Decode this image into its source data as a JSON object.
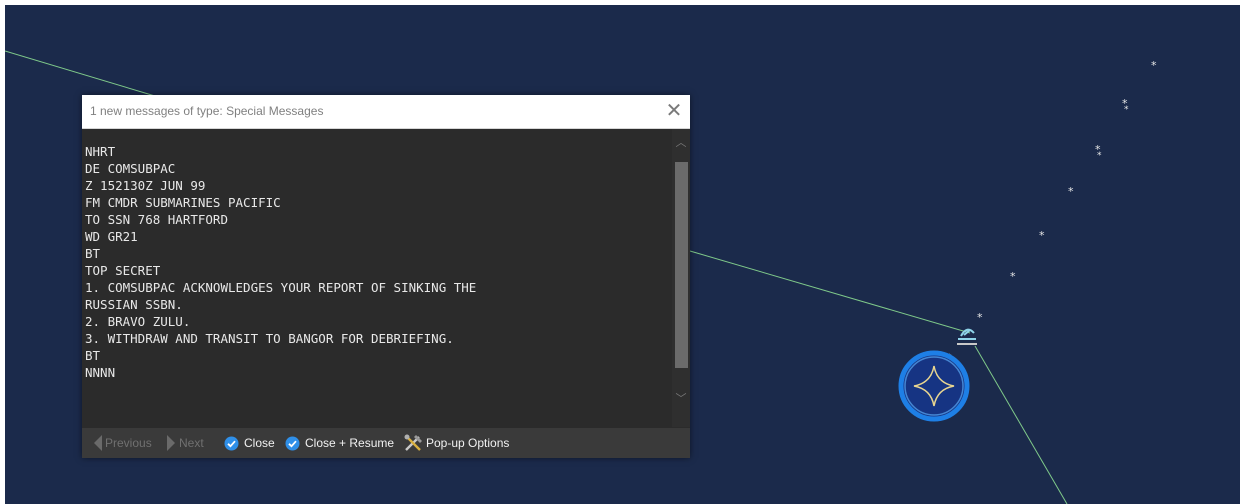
{
  "popup": {
    "title": "1 new messages of type: Special Messages",
    "close_glyph": "✕",
    "message_lines": [
      "NHRT",
      "DE COMSUBPAC",
      "Z 152130Z JUN 99",
      "FM CMDR SUBMARINES PACIFIC",
      "TO SSN 768 HARTFORD",
      "WD GR21",
      "BT",
      "TOP SECRET",
      "1. COMSUBPAC ACKNOWLEDGES YOUR REPORT OF SINKING THE",
      "RUSSIAN SSBN.",
      "2. BRAVO ZULU.",
      "3. WITHDRAW AND TRANSIT TO BANGOR FOR DEBRIEFING.",
      "BT",
      "NNNN"
    ],
    "toolbar": {
      "previous_label": "Previous",
      "next_label": "Next",
      "close_label": "Close",
      "close_resume_label": "Close + Resume",
      "popup_options_label": "Pop-up Options"
    }
  },
  "map": {
    "icons": {
      "contact_marker": "asterisk-contact-icon",
      "own_ship": "submarine-icon",
      "selected_unit": "star-unit-icon"
    }
  },
  "colors": {
    "map_background": "#1b2a4b",
    "route_line": "#7fc98a",
    "selection_ring": "#1e7fe6",
    "unit_symbol": "#e9d690",
    "check_icon": "#2f8fe8"
  }
}
